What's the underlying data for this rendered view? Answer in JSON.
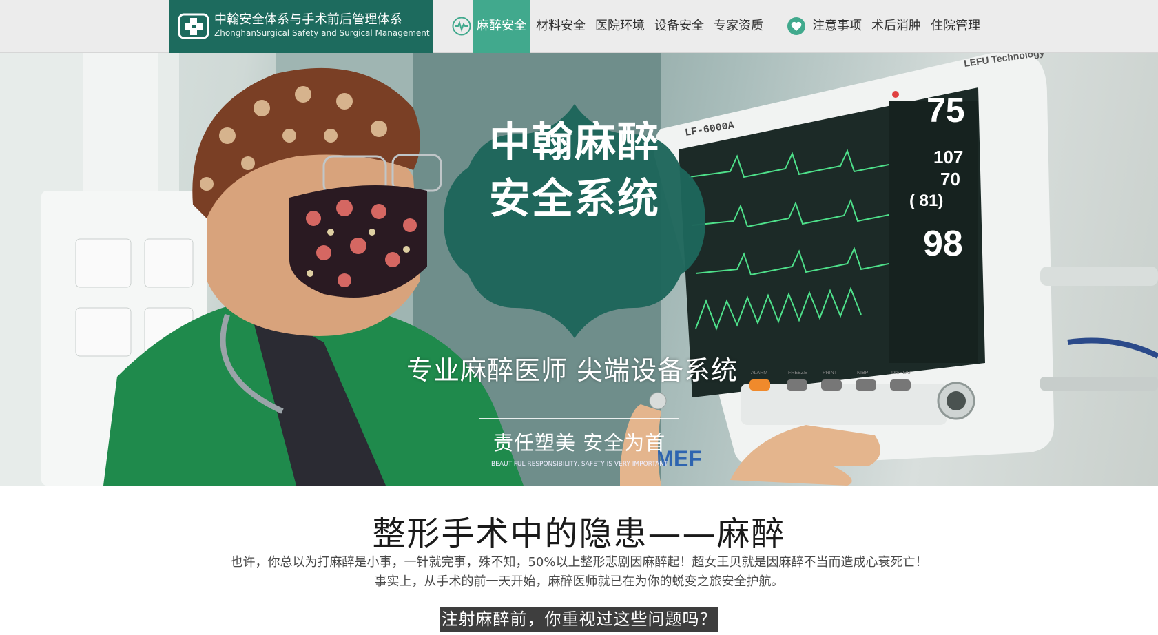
{
  "header": {
    "logo": {
      "title_cn": "中翰安全体系与手术前后管理体系",
      "title_en": "ZhonghanSurgical Safety and Surgical Management"
    },
    "nav_group_1": {
      "icon": "heartbeat-icon",
      "items": [
        "麻醉安全",
        "材料安全",
        "医院环境",
        "设备安全",
        "专家资质"
      ],
      "active": "麻醉安全"
    },
    "nav_group_2": {
      "icon": "heart-icon",
      "items": [
        "注意事项",
        "术后消肿",
        "住院管理"
      ]
    }
  },
  "hero": {
    "badge_line1": "中翰麻醉",
    "badge_line2": "安全系统",
    "slogan": "专业麻醉医师  尖端设备系统",
    "box_cn": "责任塑美  安全为首",
    "box_en": "BEAUTIFUL RESPONSIBILITY, SAFETY IS VERY IMPORTANT",
    "monitor": {
      "brand": "LEFU Technology",
      "model": "LF-6000A",
      "heart_rate": "75",
      "systolic": "107",
      "diastolic": "70",
      "mean": "( 81)",
      "spo2": "98",
      "logo": "SMEF",
      "button_labels": [
        "ALARM",
        "FREEZE",
        "PRINT",
        "NIBP",
        "DISPLAY"
      ]
    }
  },
  "content": {
    "title": "整形手术中的隐患——麻醉",
    "intro_line1": "也许，你总以为打麻醉是小事，一针就完事，殊不知，50%以上整形悲剧因麻醉起！超女王贝就是因麻醉不当而造成心衰死亡！",
    "intro_line2": "事实上，从手术的前一天开始，麻醉医师就已在为你的蜕变之旅安全护航。",
    "question": "注射麻醉前，你重视过这些问题吗？"
  },
  "colors": {
    "brand_dark": "#1d6b5e",
    "nav_active": "#41a98d",
    "badge": "#1e665b",
    "question_bg": "#3e3e3e"
  }
}
